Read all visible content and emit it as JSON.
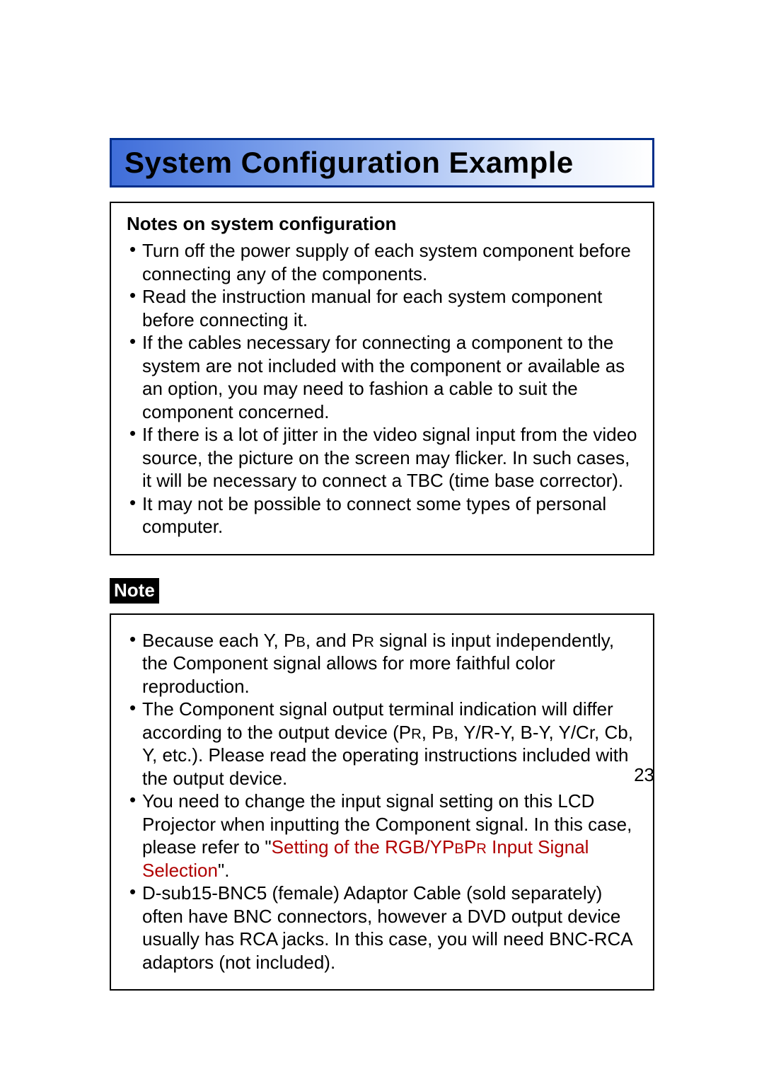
{
  "title": "System Configuration Example",
  "notes_heading": "Notes on system configuration",
  "notes_items": [
    "Turn off the power supply of each system component before connecting any of the components.",
    "Read the instruction manual for each system component before connecting it.",
    "If the cables necessary for connecting a component to the system are not included with the component or available as an option, you may need to fashion a cable to suit the component concerned.",
    "If there is a lot of jitter in the video signal input from the video source, the picture on the screen may flicker. In such cases, it will be necessary to connect a TBC (time base corrector).",
    "It may not be possible to connect some types of personal computer."
  ],
  "note_label": "Note",
  "note_items": {
    "0_a": "Because each Y, P",
    "0_b": "B",
    "0_c": ", and P",
    "0_d": "R",
    "0_e": " signal is input independently, the Component signal allows for more faithful color reproduction.",
    "1_a": "The Component signal output terminal indication will differ according to the output device (P",
    "1_b": "R",
    "1_c": ", P",
    "1_d": "B",
    "1_e": ", Y/R-Y, B-Y, Y/Cr, Cb, Y, etc.). Please read the operating instructions included with the output device.",
    "2_a": "You need to change the input signal setting on this LCD Projector when inputting the Component signal. In this case, please refer to \"",
    "2_link_a": "Setting of the RGB/YP",
    "2_link_b": "B",
    "2_link_c": "P",
    "2_link_d": "R",
    "2_link_e": " Input Signal Selection",
    "2_b": "\".",
    "3": "D-sub15-BNC5 (female) Adaptor Cable (sold separately) often have BNC connectors, however a DVD output device usually has RCA jacks. In this case, you will need BNC-RCA adaptors (not included)."
  },
  "page_number": "23"
}
